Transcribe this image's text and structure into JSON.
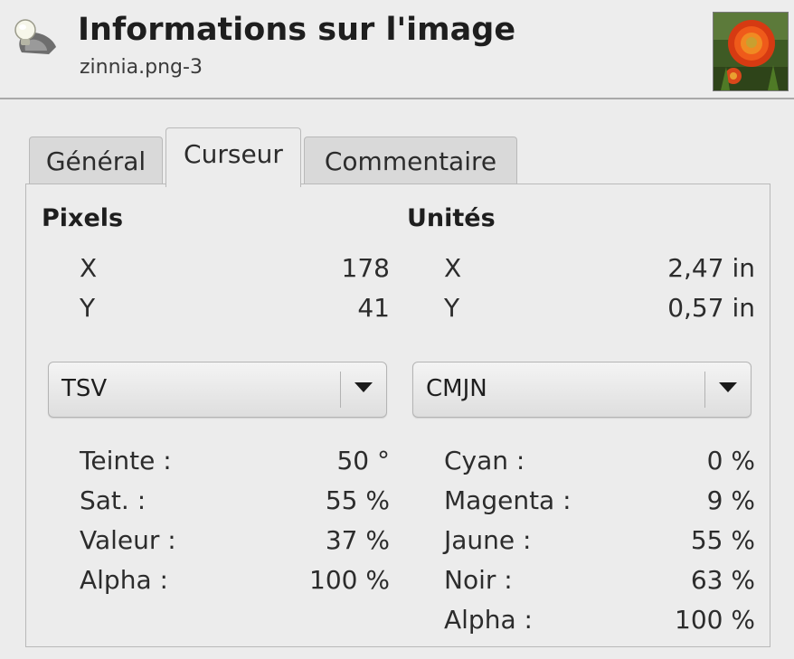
{
  "header": {
    "title": "Informations sur l'image",
    "subtitle": "zinnia.png-3",
    "icon": "info-lightbulb-icon",
    "thumbnail": "zinnia-flower-thumbnail"
  },
  "tabs": [
    {
      "label": "Général",
      "active": false
    },
    {
      "label": "Curseur",
      "active": true
    },
    {
      "label": "Commentaire",
      "active": false
    }
  ],
  "pixels": {
    "heading": "Pixels",
    "x_label": "X",
    "x_value": "178",
    "y_label": "Y",
    "y_value": "41"
  },
  "units": {
    "heading": "Unités",
    "x_label": "X",
    "x_value": "2,47 in",
    "y_label": "Y",
    "y_value": "0,57 in"
  },
  "left_mode": {
    "selected": "TSV",
    "rows": [
      {
        "label": "Teinte :",
        "value": "50 °"
      },
      {
        "label": "Sat. :",
        "value": "55 %"
      },
      {
        "label": "Valeur :",
        "value": "37 %"
      },
      {
        "label": "Alpha :",
        "value": "100 %"
      }
    ]
  },
  "right_mode": {
    "selected": "CMJN",
    "rows": [
      {
        "label": "Cyan :",
        "value": "0 %"
      },
      {
        "label": "Magenta :",
        "value": "9 %"
      },
      {
        "label": "Jaune :",
        "value": "55 %"
      },
      {
        "label": "Noir :",
        "value": "63 %"
      },
      {
        "label": "Alpha :",
        "value": "100 %"
      }
    ]
  },
  "colors": {
    "background": "#ececec",
    "tab_inactive": "#d9d9d9",
    "border": "#b9b9b9"
  }
}
